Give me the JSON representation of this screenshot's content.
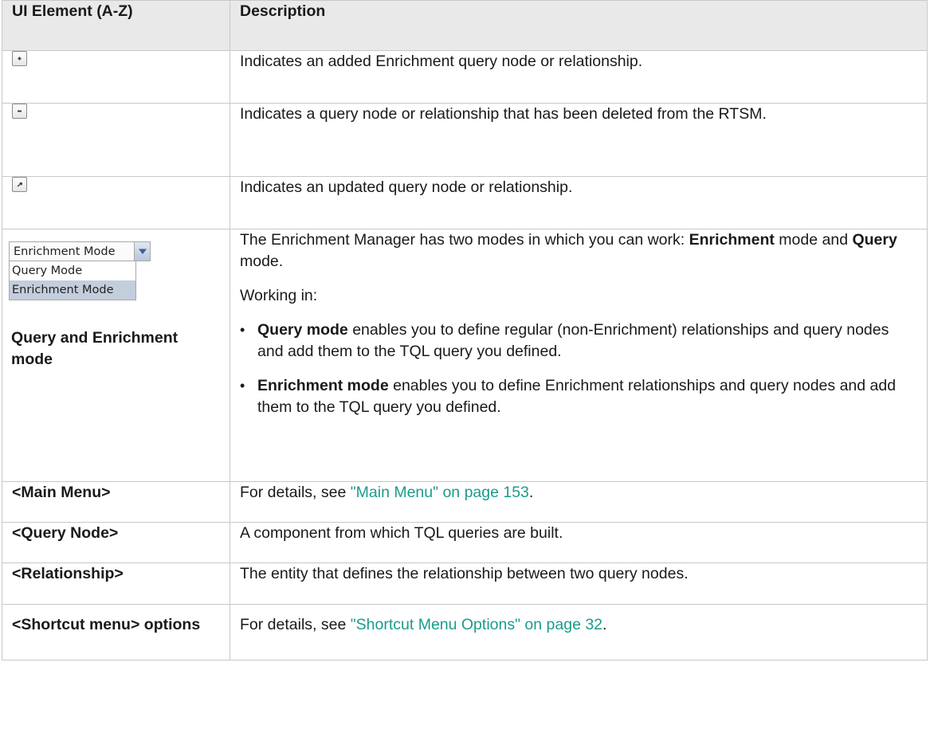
{
  "table": {
    "headers": [
      "UI Element (A-Z)",
      "Description"
    ],
    "row_added": {
      "icon": "added-plus-icon",
      "description": "Indicates an added Enrichment query node or relationship."
    },
    "row_deleted": {
      "icon": "deleted-minus-icon",
      "description": "Indicates a query node or relationship that has been deleted from the RTSM."
    },
    "row_updated": {
      "icon": "updated-arrow-icon",
      "description": "Indicates an updated query node or relationship."
    },
    "row_mode": {
      "dropdown": {
        "selected": "Enrichment Mode",
        "options": [
          "Query Mode",
          "Enrichment Mode"
        ]
      },
      "element_label": "Query and Enrichment mode",
      "intro_prefix": "The Enrichment Manager has two modes in which you can work: ",
      "intro_bold_1": "Enrichment",
      "intro_mid": " mode and ",
      "intro_bold_2": "Query",
      "intro_suffix": " mode.",
      "working_in": "Working in:",
      "bullets": [
        {
          "bold": "Query mode",
          "text": " enables you to define regular (non-Enrichment) relationships and query nodes and add them to the TQL query you defined."
        },
        {
          "bold": "Enrichment mode",
          "text": " enables you to define Enrichment relationships and query nodes and add them to the TQL query you defined."
        }
      ]
    },
    "row_main_menu": {
      "element": "<Main Menu>",
      "prefix": "For details, see ",
      "link": "\"Main Menu\" on page 153",
      "suffix": "."
    },
    "row_query_node": {
      "element": "<Query Node>",
      "description": "A component from which TQL queries are built."
    },
    "row_relationship": {
      "element": "<Relationship>",
      "description": "The entity that defines the relationship between two query nodes."
    },
    "row_shortcut": {
      "element": "<Shortcut menu> options",
      "prefix": "For details, see ",
      "link": "\"Shortcut Menu Options\" on page 32",
      "suffix": "."
    }
  },
  "colors": {
    "link": "#1a9c8c",
    "header_bg": "#e9e9e9",
    "border": "#c8c8c8"
  }
}
